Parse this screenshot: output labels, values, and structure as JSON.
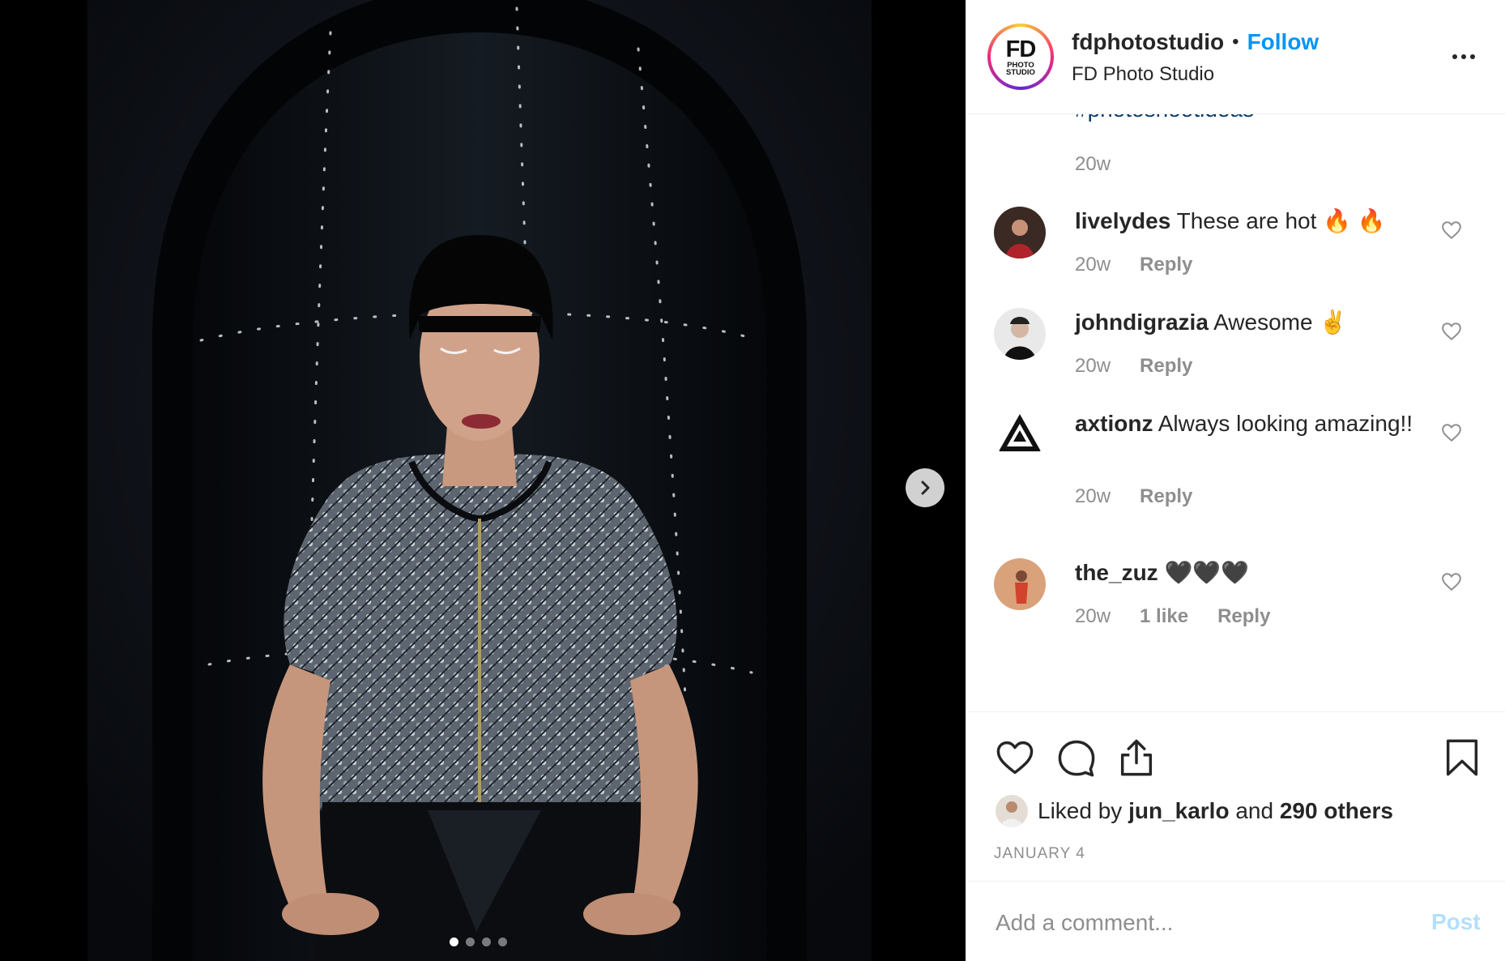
{
  "post": {
    "media": {
      "image_alt": "",
      "carousel": {
        "total": 4,
        "active_index": 1
      },
      "next_icon": "chevron-right-icon"
    },
    "header": {
      "avatar_logo": {
        "line1": "FD",
        "line2": "PHOTO",
        "line3": "STUDIO"
      },
      "username": "fdphotostudio",
      "separator": "•",
      "follow_label": "Follow",
      "full_name": "FD Photo Studio",
      "more_icon": "more-horizontal-icon"
    },
    "caption": {
      "visible_tag": "#photoshootideas",
      "time": "20w"
    },
    "comments": [
      {
        "username": "livelydes",
        "text": "These are hot 🔥 🔥",
        "time": "20w",
        "likes": "",
        "reply_label": "Reply"
      },
      {
        "username": "johndigrazia",
        "text": "Awesome ✌️",
        "time": "20w",
        "likes": "",
        "reply_label": "Reply"
      },
      {
        "username": "axtionz",
        "text": "Always looking amazing!!",
        "time": "20w",
        "likes": "",
        "reply_label": "Reply"
      },
      {
        "username": "the_zuz",
        "text": "🖤🖤🖤",
        "time": "20w",
        "likes": "1 like",
        "reply_label": "Reply"
      }
    ],
    "actions": {
      "like_icon": "heart-icon",
      "comment_icon": "comment-icon",
      "share_icon": "share-icon",
      "save_icon": "bookmark-icon",
      "liked_prefix": "Liked by",
      "liked_user": "jun_karlo",
      "liked_and": "and",
      "liked_others": "290 others",
      "date": "JANUARY 4"
    },
    "add_comment": {
      "placeholder": "Add a comment...",
      "post_label": "Post"
    }
  },
  "colors": {
    "accent": "#0095f6",
    "text": "#262626",
    "muted": "#8e8e8e",
    "hashtag": "#00376b",
    "post_disabled": "#b2dffc",
    "border": "#efefef"
  }
}
